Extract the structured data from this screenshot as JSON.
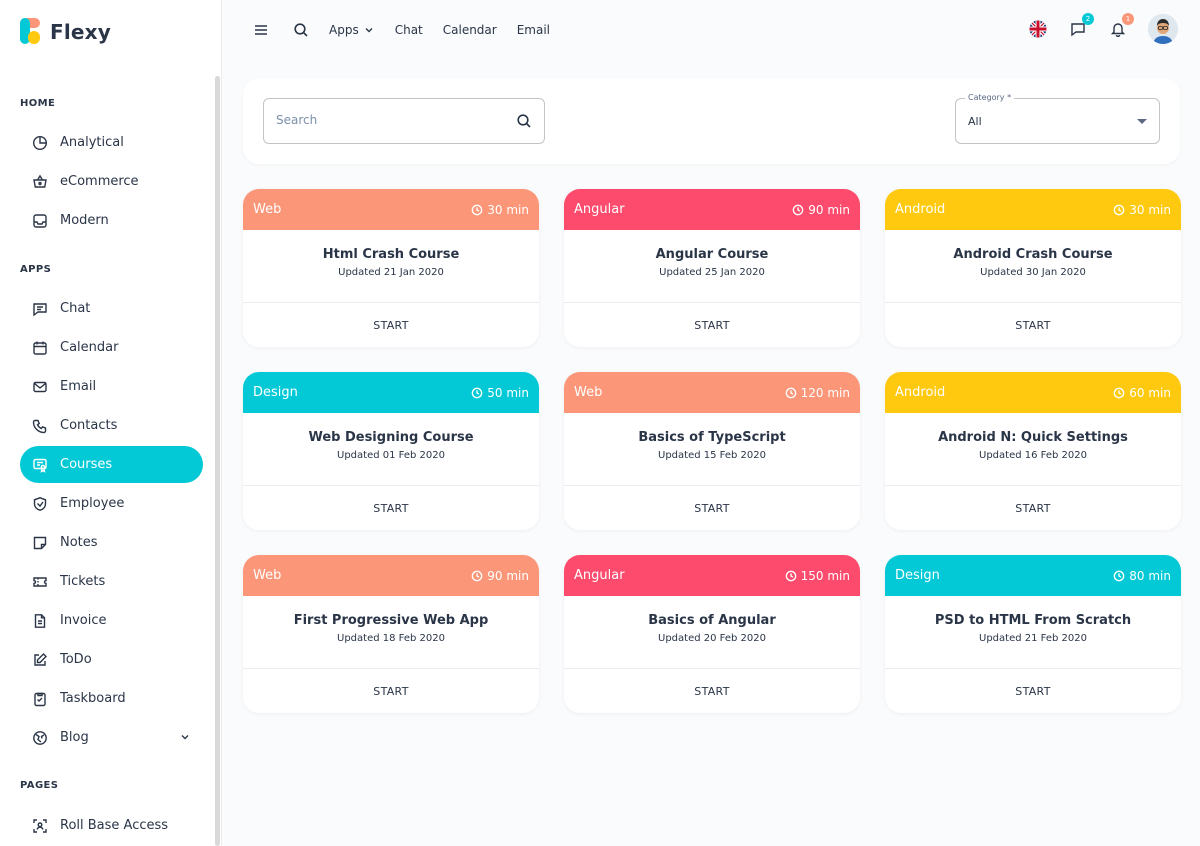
{
  "app": {
    "name": "Flexy"
  },
  "colors": {
    "accent": "#03c9d7",
    "web": "#fb9678",
    "angular": "#fc4b6c",
    "android": "#fec90f",
    "design": "#03c9d7"
  },
  "sidebar": {
    "sections": [
      {
        "label": "HOME"
      },
      {
        "label": "APPS"
      },
      {
        "label": "PAGES"
      }
    ],
    "items": [
      {
        "label": "Analytical",
        "icon": "pie-chart-icon"
      },
      {
        "label": "eCommerce",
        "icon": "basket-icon"
      },
      {
        "label": "Modern",
        "icon": "inbox-icon"
      },
      {
        "label": "Chat",
        "icon": "message-icon"
      },
      {
        "label": "Calendar",
        "icon": "calendar-icon"
      },
      {
        "label": "Email",
        "icon": "mail-icon"
      },
      {
        "label": "Contacts",
        "icon": "phone-icon"
      },
      {
        "label": "Courses",
        "icon": "certificate-icon",
        "active": true
      },
      {
        "label": "Employee",
        "icon": "shield-icon"
      },
      {
        "label": "Notes",
        "icon": "note-icon"
      },
      {
        "label": "Tickets",
        "icon": "ticket-icon"
      },
      {
        "label": "Invoice",
        "icon": "file-icon"
      },
      {
        "label": "ToDo",
        "icon": "edit-icon"
      },
      {
        "label": "Taskboard",
        "icon": "clipboard-icon"
      },
      {
        "label": "Blog",
        "icon": "globe-icon"
      },
      {
        "label": "Roll Base Access",
        "icon": "scan-user-icon"
      }
    ]
  },
  "header": {
    "links": [
      "Apps",
      "Chat",
      "Calendar",
      "Email"
    ],
    "chat_badge": "2",
    "notification_badge": "1"
  },
  "filter": {
    "search_placeholder": "Search",
    "category_label": "Category *",
    "category_value": "All"
  },
  "courses": [
    {
      "category": "Web",
      "duration": "30 min",
      "title": "Html Crash Course",
      "updated": "Updated 21 Jan 2020",
      "action": "START"
    },
    {
      "category": "Angular",
      "duration": "90 min",
      "title": "Angular Course",
      "updated": "Updated 25 Jan 2020",
      "action": "START"
    },
    {
      "category": "Android",
      "duration": "30 min",
      "title": "Android Crash Course",
      "updated": "Updated 30 Jan 2020",
      "action": "START"
    },
    {
      "category": "Design",
      "duration": "50 min",
      "title": "Web Designing Course",
      "updated": "Updated 01 Feb 2020",
      "action": "START"
    },
    {
      "category": "Web",
      "duration": "120 min",
      "title": "Basics of TypeScript",
      "updated": "Updated 15 Feb 2020",
      "action": "START"
    },
    {
      "category": "Android",
      "duration": "60 min",
      "title": "Android N: Quick Settings",
      "updated": "Updated 16 Feb 2020",
      "action": "START"
    },
    {
      "category": "Web",
      "duration": "90 min",
      "title": "First Progressive Web App",
      "updated": "Updated 18 Feb 2020",
      "action": "START"
    },
    {
      "category": "Angular",
      "duration": "150 min",
      "title": "Basics of Angular",
      "updated": "Updated 20 Feb 2020",
      "action": "START"
    },
    {
      "category": "Design",
      "duration": "80 min",
      "title": "PSD to HTML From Scratch",
      "updated": "Updated 21 Feb 2020",
      "action": "START"
    }
  ]
}
